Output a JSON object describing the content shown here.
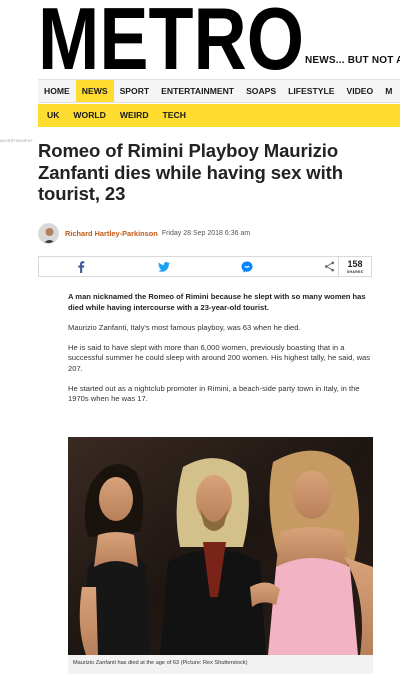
{
  "header": {
    "logo_text": "METRO",
    "tagline": "NEWS... BUT NOT A"
  },
  "primary_nav": [
    {
      "label": "HOME",
      "active": false
    },
    {
      "label": "NEWS",
      "active": true
    },
    {
      "label": "SPORT",
      "active": false
    },
    {
      "label": "ENTERTAINMENT",
      "active": false
    },
    {
      "label": "SOAPS",
      "active": false
    },
    {
      "label": "LIFESTYLE",
      "active": false
    },
    {
      "label": "VIDEO",
      "active": false
    },
    {
      "label": "M",
      "active": false
    }
  ],
  "secondary_nav": [
    "UK",
    "WORLD",
    "WEIRD",
    "TECH"
  ],
  "ad_label": "ADVERTISEMENT",
  "article": {
    "headline": "Romeo of Rimini Playboy Maurizio Zanfanti dies while having sex with tourist, 23",
    "author": "Richard Hartley-Parkinson",
    "date": "Friday 28 Sep 2018 6:36 am",
    "paragraphs": [
      "A man nicknamed the Romeo of Rimini because he slept with so many women has died while having intercourse with a 23-year-old tourist.",
      "Maurizio Zanfanti, Italy's most famous playboy, was 63 when he died.",
      "He is said to have slept with more than 6,000 women, previously boasting that in a successful summer he could sleep with around 200 women. His highest tally, he said, was 207.",
      "He started out as a nightclub promoter in Rimini, a beach-side party town in Italy, in the 1970s when he was 17."
    ],
    "caption": "Maurizio Zanfanti has died at the age of 63 (Picture: Rex Shutterstock)"
  },
  "share": {
    "icons": [
      "facebook-icon",
      "twitter-icon",
      "messenger-icon",
      "share-icon"
    ],
    "count": "158",
    "count_label": "SHARES"
  },
  "colors": {
    "brand_yellow": "#fedc30",
    "author_orange": "#c15a17",
    "facebook": "#3b5998",
    "twitter": "#1da1f2",
    "messenger": "#0084ff"
  }
}
